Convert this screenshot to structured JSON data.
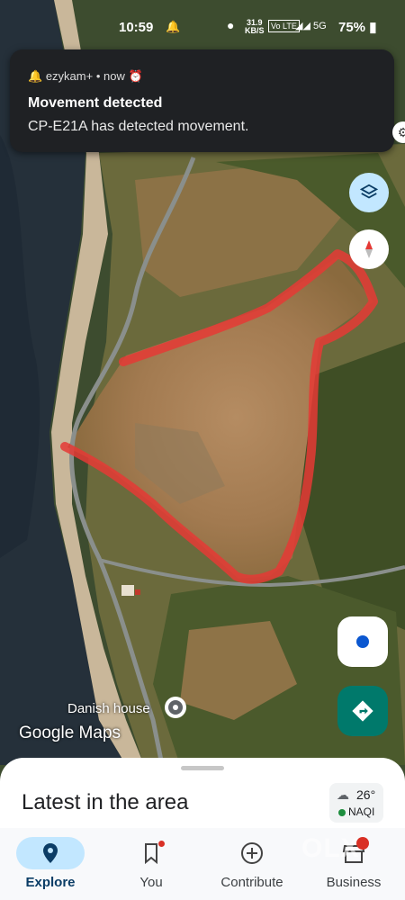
{
  "status_bar": {
    "time": "10:59",
    "speed_value": "31.9",
    "speed_unit": "KB/S",
    "volte": "Vo LTE",
    "network": "5G",
    "battery": "75%"
  },
  "notification": {
    "app_name": "ezykam+",
    "time": "now",
    "title": "Movement detected",
    "body": "CP-E21A  has detected movement."
  },
  "map": {
    "place_label": "Danish house",
    "watermark": "Google Maps",
    "route_color": "#e53935",
    "accent": "#0b57d0",
    "directions_color": "#00796b"
  },
  "sheet": {
    "title": "Latest in the area"
  },
  "weather": {
    "temperature": "26°",
    "aqi": "NAQI"
  },
  "nav": {
    "items": [
      {
        "label": "Explore",
        "icon": "explore-pin-icon",
        "active": true
      },
      {
        "label": "You",
        "icon": "bookmark-icon"
      },
      {
        "label": "Contribute",
        "icon": "add-circle-icon"
      },
      {
        "label": "Business",
        "icon": "store-icon"
      }
    ]
  },
  "overlay_watermark": "OLX"
}
